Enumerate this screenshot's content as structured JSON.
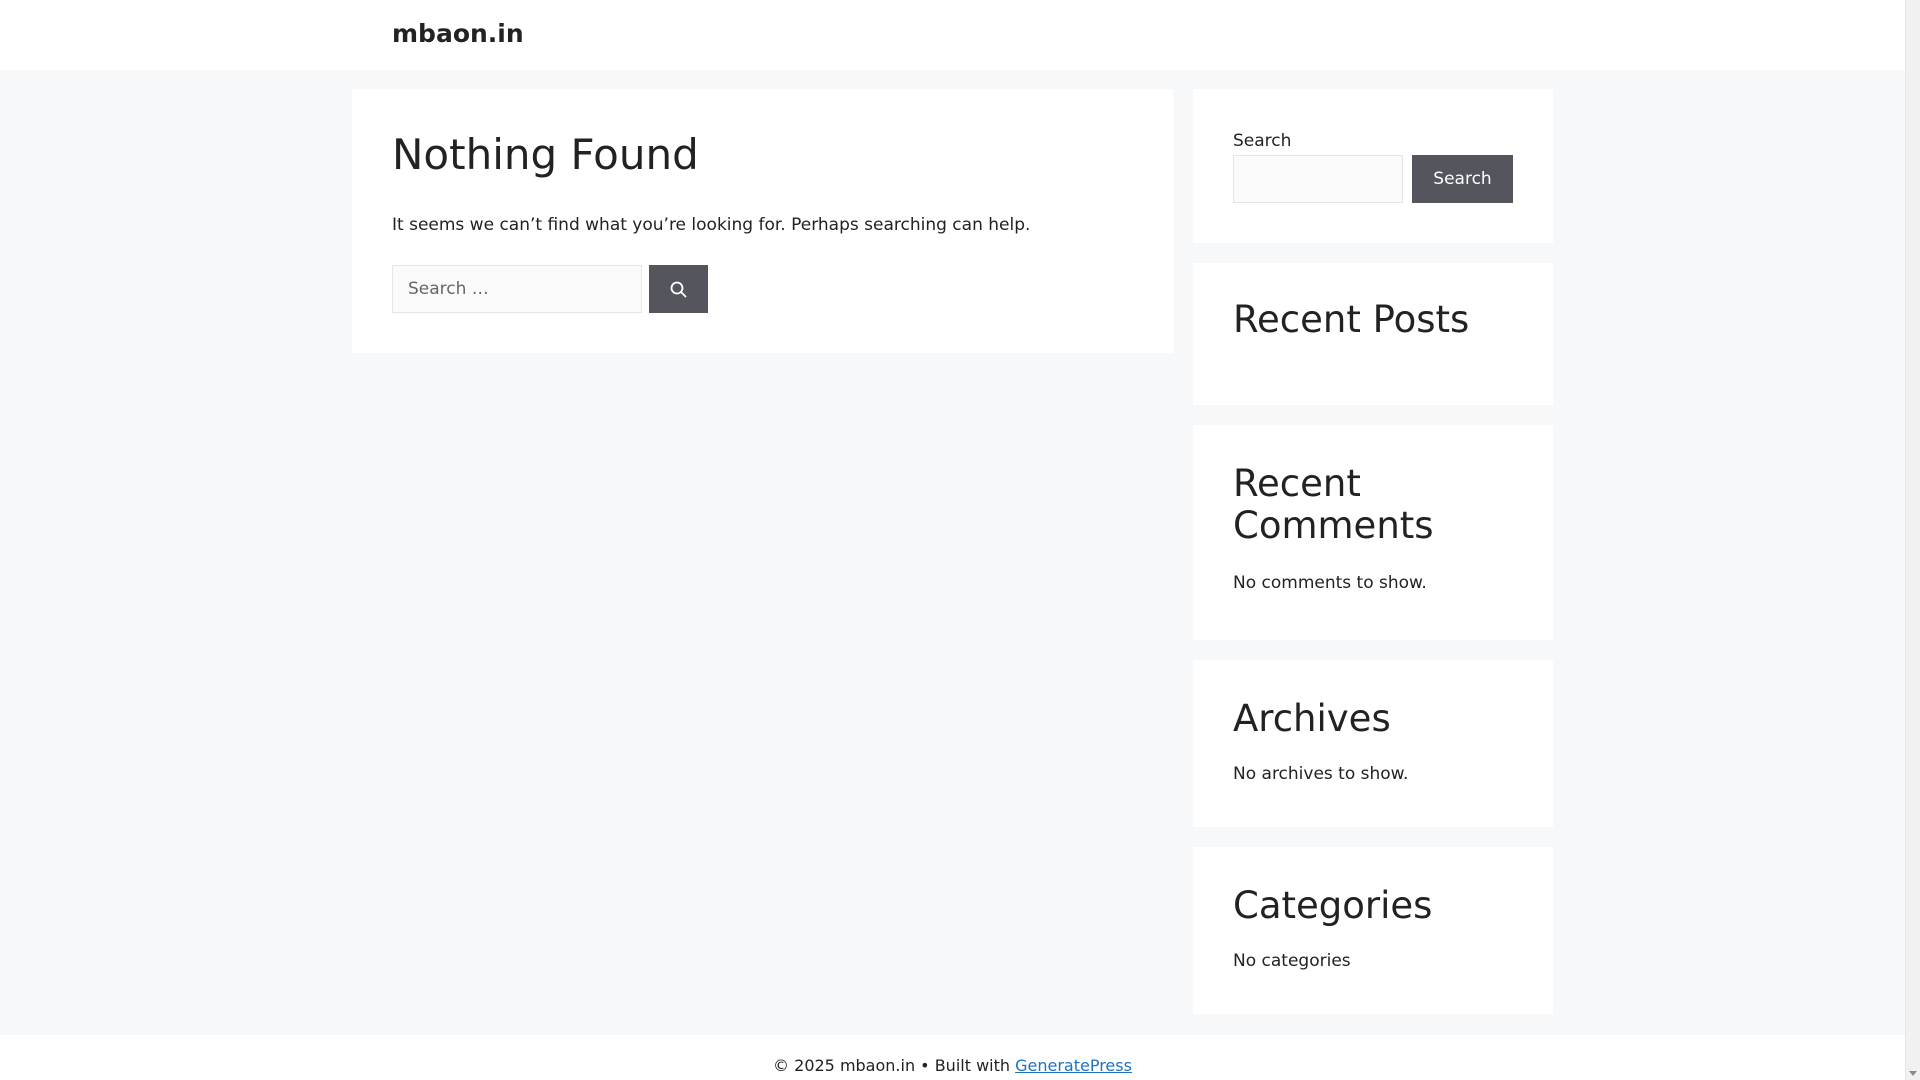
{
  "header": {
    "site_title": "mbaon.in"
  },
  "main": {
    "title": "Nothing Found",
    "message": "It seems we can’t find what you’re looking for. Perhaps searching can help.",
    "search": {
      "placeholder": "Search …",
      "button_icon": "search-icon"
    }
  },
  "sidebar": {
    "search_widget": {
      "label": "Search",
      "input_value": "",
      "button_label": "Search"
    },
    "recent_posts": {
      "title": "Recent Posts"
    },
    "recent_comments": {
      "title": "Recent Comments",
      "text": "No comments to show."
    },
    "archives": {
      "title": "Archives",
      "text": "No archives to show."
    },
    "categories": {
      "title": "Categories",
      "text": "No categories"
    }
  },
  "footer": {
    "copyright": "© 2025 mbaon.in • Built with",
    "link_label": "GeneratePress",
    "link_color": "#1e73be"
  },
  "colors": {
    "background": "#f7f8f9",
    "card": "#ffffff",
    "button": "#55555e",
    "text": "#222222"
  }
}
